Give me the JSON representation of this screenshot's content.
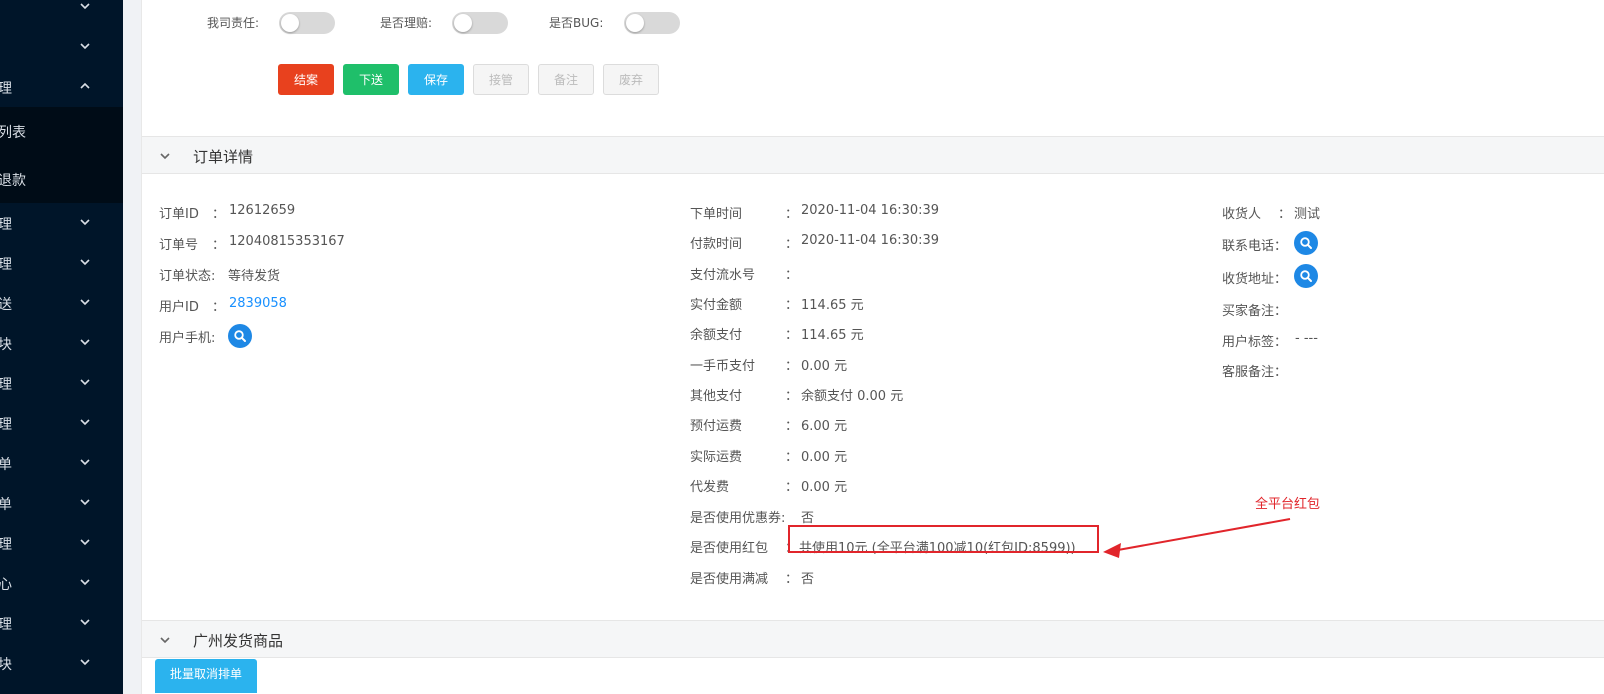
{
  "sidebar": {
    "items": [
      {
        "label": "",
        "chevron": "down"
      },
      {
        "label": "",
        "chevron": "down"
      },
      {
        "label": "理",
        "chevron": "up"
      },
      {
        "label": "列表",
        "chevron": ""
      },
      {
        "label": "退款",
        "chevron": ""
      },
      {
        "label": "理",
        "chevron": "down"
      },
      {
        "label": "理",
        "chevron": "down"
      },
      {
        "label": "送",
        "chevron": "down"
      },
      {
        "label": "块",
        "chevron": "down"
      },
      {
        "label": "理",
        "chevron": "down"
      },
      {
        "label": "理",
        "chevron": "down"
      },
      {
        "label": "单",
        "chevron": "down"
      },
      {
        "label": "单",
        "chevron": "down"
      },
      {
        "label": "理",
        "chevron": "down"
      },
      {
        "label": "心",
        "chevron": "down"
      },
      {
        "label": "理",
        "chevron": "down"
      },
      {
        "label": "块",
        "chevron": "down"
      }
    ]
  },
  "toggles": [
    {
      "label": "我司责任:",
      "on": false
    },
    {
      "label": "是否理赔:",
      "on": false
    },
    {
      "label": "是否BUG:",
      "on": false
    }
  ],
  "actions": {
    "close_case": "结案",
    "send_down": "下送",
    "save": "保存",
    "take_over": "接管",
    "remark": "备注",
    "discard": "废弃"
  },
  "order_section": {
    "title": "订单详情",
    "col1": [
      {
        "label": "订单ID",
        "sep": "：",
        "value": "12612659"
      },
      {
        "label": "订单号",
        "sep": "：",
        "value": "12040815353167"
      },
      {
        "label": "订单状态:",
        "sep": "",
        "value": "等待发货"
      },
      {
        "label": "用户ID",
        "sep": "：",
        "value": "2839058"
      },
      {
        "label": "用户手机:",
        "sep": "",
        "value": ""
      }
    ],
    "col2": [
      {
        "label": "下单时间",
        "sep": "：",
        "value": "2020-11-04 16:30:39"
      },
      {
        "label": "付款时间",
        "sep": "：",
        "value": "2020-11-04 16:30:39"
      },
      {
        "label": "支付流水号",
        "sep": "：",
        "value": ""
      },
      {
        "label": "实付金额",
        "sep": "：",
        "value": "114.65 元"
      },
      {
        "label": "余额支付",
        "sep": "：",
        "value": "114.65 元"
      },
      {
        "label": "一手币支付",
        "sep": "：",
        "value": "0.00 元"
      },
      {
        "label": "其他支付",
        "sep": "：",
        "value": "余额支付 0.00 元"
      },
      {
        "label": "预付运费",
        "sep": "：",
        "value": "6.00 元"
      },
      {
        "label": "实际运费",
        "sep": "：",
        "value": "0.00 元"
      },
      {
        "label": "代发费",
        "sep": "：",
        "value": "0.00 元"
      },
      {
        "label": "是否使用优惠券:",
        "sep": "",
        "value": "否"
      },
      {
        "label": "是否使用红包",
        "sep": "：",
        "value": "共使用10元 (全平台满100减10(红包ID:8599))"
      },
      {
        "label": "是否使用满减",
        "sep": "：",
        "value": "否"
      }
    ],
    "col3": [
      {
        "label": "收货人",
        "sep": "：",
        "value": "测试"
      },
      {
        "label": "联系电话：",
        "sep": "",
        "value": ""
      },
      {
        "label": "收货地址：",
        "sep": "",
        "value": ""
      },
      {
        "label": "买家备注：",
        "sep": "",
        "value": ""
      },
      {
        "label": "用户标签：",
        "sep": "",
        "value": "- ---"
      },
      {
        "label": "客服备注：",
        "sep": "",
        "value": ""
      }
    ]
  },
  "annotation": {
    "text": "全平台红包",
    "color": "#e1252b"
  },
  "goods_section": {
    "title": "广州发货商品",
    "batch_button": "批量取消排单"
  },
  "colors": {
    "sidebar_bg": "#001529",
    "link": "#1890ff",
    "search_btn": "#1e88e5",
    "danger": "#e8411e",
    "success": "#1fbf6a",
    "primary": "#2bb3ee"
  }
}
